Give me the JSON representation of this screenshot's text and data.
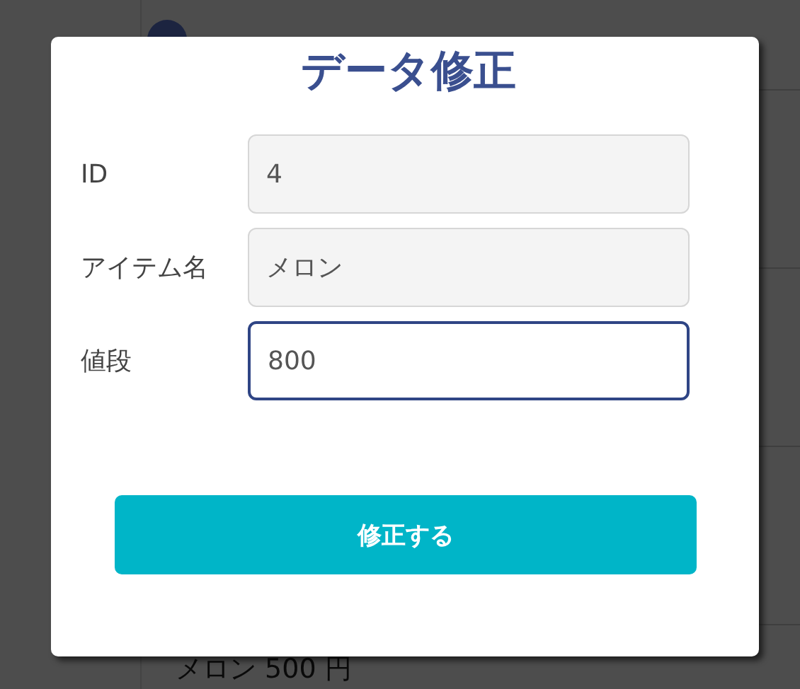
{
  "background": {
    "item_text": "メロン 500 円"
  },
  "dialog": {
    "title": "データ修正",
    "fields": [
      {
        "label": "ID",
        "value": "4",
        "readonly": true,
        "focused": false
      },
      {
        "label": "アイテム名",
        "value": "メロン",
        "readonly": true,
        "focused": false
      },
      {
        "label": "値段",
        "value": "800",
        "readonly": false,
        "focused": true
      }
    ],
    "submit": "修正する"
  }
}
